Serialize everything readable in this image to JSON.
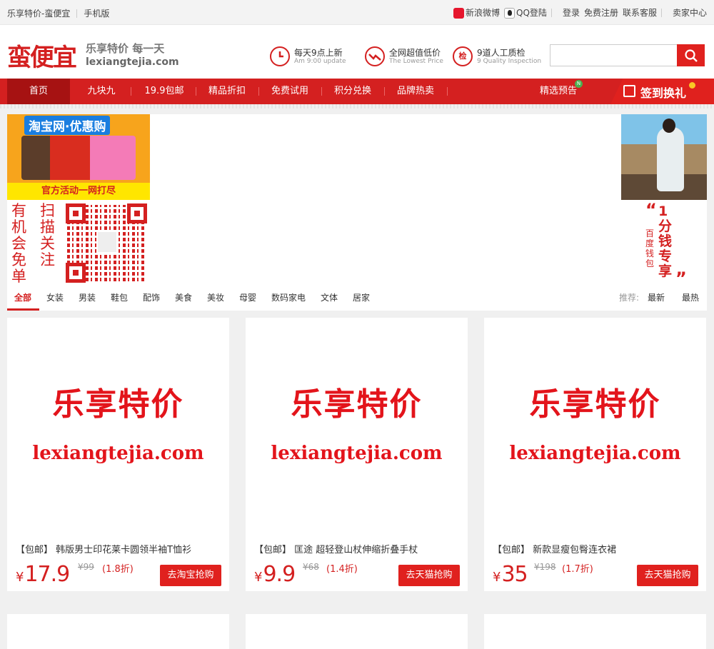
{
  "topbar": {
    "site_name": "乐享特价-蛮便宜",
    "mobile": "手机版",
    "weibo": "新浪微博",
    "qq_login": "QQ登陆",
    "login": "登录",
    "register": "免费注册",
    "service": "联系客服",
    "seller": "卖家中心"
  },
  "header": {
    "logo": "蛮便宜",
    "slogan": "乐享特价 每一天",
    "domain": "lexiangtejia.com",
    "features": [
      {
        "icon": "clock-icon",
        "title": "每天9点上新",
        "sub": "Am 9:00 update"
      },
      {
        "icon": "lowest-price-icon",
        "title": "全网超值低价",
        "sub": "The Lowest Price"
      },
      {
        "icon": "quality-check-icon",
        "glyph": "检",
        "title": "9道人工质检",
        "sub": "9 Quality Inspection"
      }
    ],
    "search_placeholder": ""
  },
  "nav": {
    "items": [
      "首页",
      "九块九",
      "19.9包邮",
      "精品折扣",
      "免费试用",
      "积分兑换",
      "品牌热卖"
    ],
    "preview": "精选预告",
    "preview_badge": "N",
    "signin": "签到换礼"
  },
  "banners": {
    "taobao_title": "淘宝网·优惠购",
    "taobao_footer": "官方活动一网打尽",
    "qr_text_left": "有机会免单",
    "qr_text_right": "扫描关注",
    "right_big": "1分钱专享",
    "right_small": "百度钱包",
    "quote_open": "“",
    "quote_close": "”"
  },
  "categories": {
    "items": [
      "全部",
      "女装",
      "男装",
      "鞋包",
      "配饰",
      "美食",
      "美妆",
      "母婴",
      "数码家电",
      "文体",
      "居家"
    ],
    "active": "全部",
    "sort_label": "推荐:",
    "sort_options": [
      "最新",
      "最热"
    ]
  },
  "products": [
    {
      "brand": "乐享特价",
      "domain": "lexiangtejia.com",
      "tag": "【包邮】",
      "name": "韩版男士印花莱卡圆领半袖T恤衫",
      "yen": "¥",
      "price": "17.9",
      "orig": "¥99",
      "discount": "(1.8折)",
      "button": "去淘宝抢购"
    },
    {
      "brand": "乐享特价",
      "domain": "lexiangtejia.com",
      "tag": "【包邮】",
      "name": "匡途 超轻登山杖伸缩折叠手杖",
      "yen": "¥",
      "price": "9.9",
      "orig": "¥68",
      "discount": "(1.4折)",
      "button": "去天猫抢购"
    },
    {
      "brand": "乐享特价",
      "domain": "lexiangtejia.com",
      "tag": "【包邮】",
      "name": "新款显瘦包臀连衣裙",
      "yen": "¥",
      "price": "35",
      "orig": "¥198",
      "discount": "(1.7折)",
      "button": "去天猫抢购"
    }
  ],
  "colors": {
    "brand_red": "#d42020",
    "nav_active": "#a61212",
    "button_red": "#e0211e"
  }
}
